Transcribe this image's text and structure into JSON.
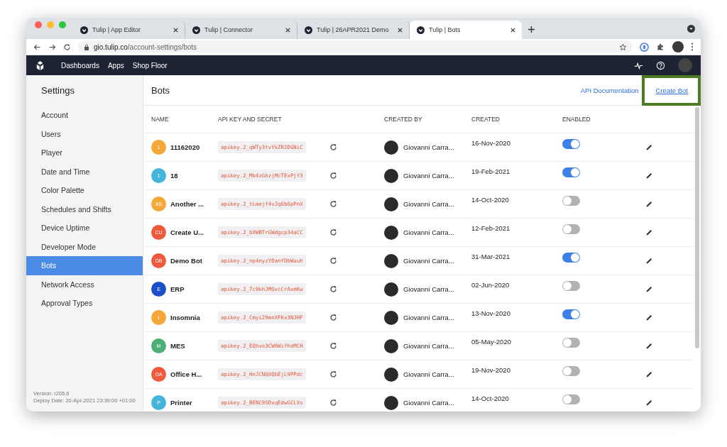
{
  "browser": {
    "tabs": [
      {
        "title": "Tulip | App Editor",
        "selected": false
      },
      {
        "title": "Tulip | Connector",
        "selected": false
      },
      {
        "title": "Tulip | 26APR2021 Demo",
        "selected": false
      },
      {
        "title": "Tulip | Bots",
        "selected": true
      }
    ],
    "url": {
      "host": "gio.tulip.co",
      "path": "/account-settings/bots"
    }
  },
  "navbar": {
    "items": [
      "Dashboards",
      "Apps",
      "Shop Floor"
    ]
  },
  "sidebar": {
    "title": "Settings",
    "items": [
      {
        "label": "Account",
        "selected": false
      },
      {
        "label": "Users",
        "selected": false
      },
      {
        "label": "Player",
        "selected": false
      },
      {
        "label": "Date and Time",
        "selected": false
      },
      {
        "label": "Color Palette",
        "selected": false
      },
      {
        "label": "Schedules and Shifts",
        "selected": false
      },
      {
        "label": "Device Uptime",
        "selected": false
      },
      {
        "label": "Developer Mode",
        "selected": false
      },
      {
        "label": "Bots",
        "selected": true
      },
      {
        "label": "Network Access",
        "selected": false
      },
      {
        "label": "Approval Types",
        "selected": false
      }
    ],
    "version": "Version: r205.6",
    "deploy_date": "Deploy Date: 20-Apr-2021 23:39:00 +01:00"
  },
  "main": {
    "title": "Bots",
    "api_link": "API Documentation",
    "create_button": {
      "label": "Create Bot",
      "highlighted": true
    }
  },
  "table": {
    "columns": [
      "NAME",
      "API KEY AND SECRET",
      "CREATED BY",
      "CREATED",
      "ENABLED"
    ],
    "rows": [
      {
        "initials": "1",
        "color": "#f5a83a",
        "name": "11162020",
        "api_key": "apikey.2_qWTy3tvYkZR2DGNiC",
        "created_by": "Giovanni Carra...",
        "created": "16-Nov-2020",
        "enabled": true
      },
      {
        "initials": "1",
        "color": "#45b6d9",
        "name": "18",
        "api_key": "apikey.2_Mb4zGhzjMcTExPjY3",
        "created_by": "Giovanni Carra...",
        "created": "19-Feb-2021",
        "enabled": true
      },
      {
        "initials": "AS",
        "color": "#f5a83a",
        "name": "Another ...",
        "api_key": "apikey.2_tLmejf4vJq6b6pPnX",
        "created_by": "Giovanni Carra...",
        "created": "14-Oct-2020",
        "enabled": false
      },
      {
        "initials": "CU",
        "color": "#ef5a3c",
        "name": "Create U...",
        "api_key": "apikey.2_bXWBTrGWdgcp34aCC",
        "created_by": "Giovanni Carra...",
        "created": "12-Feb-2021",
        "enabled": false
      },
      {
        "initials": "DB",
        "color": "#ef5a3c",
        "name": "Demo Bot",
        "api_key": "apikey.2_np4nyzYDanfDbWuuh",
        "created_by": "Giovanni Carra...",
        "created": "31-Mar-2021",
        "enabled": true
      },
      {
        "initials": "E",
        "color": "#1b4fc9",
        "name": "ERP",
        "api_key": "apikey.2_7c9khJMQvcCrAxmKw",
        "created_by": "Giovanni Carra...",
        "created": "02-Jun-2020",
        "enabled": false
      },
      {
        "initials": "I",
        "color": "#f5a83a",
        "name": "Insomnia",
        "api_key": "apikey.2_Cmyi29mnXFKx3NJHF",
        "created_by": "Giovanni Carra...",
        "created": "13-Nov-2020",
        "enabled": true
      },
      {
        "initials": "M",
        "color": "#4caf74",
        "name": "MES",
        "api_key": "apikey.2_EQhvo3CW6WifhoMCH",
        "created_by": "Giovanni Carra...",
        "created": "05-May-2020",
        "enabled": false
      },
      {
        "initials": "OA",
        "color": "#ef5a3c",
        "name": "Office H...",
        "api_key": "apikey.2_HnJCNQ8QbEjL9PPdc",
        "created_by": "Giovanni Carra...",
        "created": "19-Nov-2020",
        "enabled": false
      },
      {
        "initials": "P",
        "color": "#45b6d9",
        "name": "Printer",
        "api_key": "apikey.2_BENC9SDxqEdwGCLXs",
        "created_by": "Giovanni Carra...",
        "created": "14-Oct-2020",
        "enabled": false
      }
    ]
  }
}
